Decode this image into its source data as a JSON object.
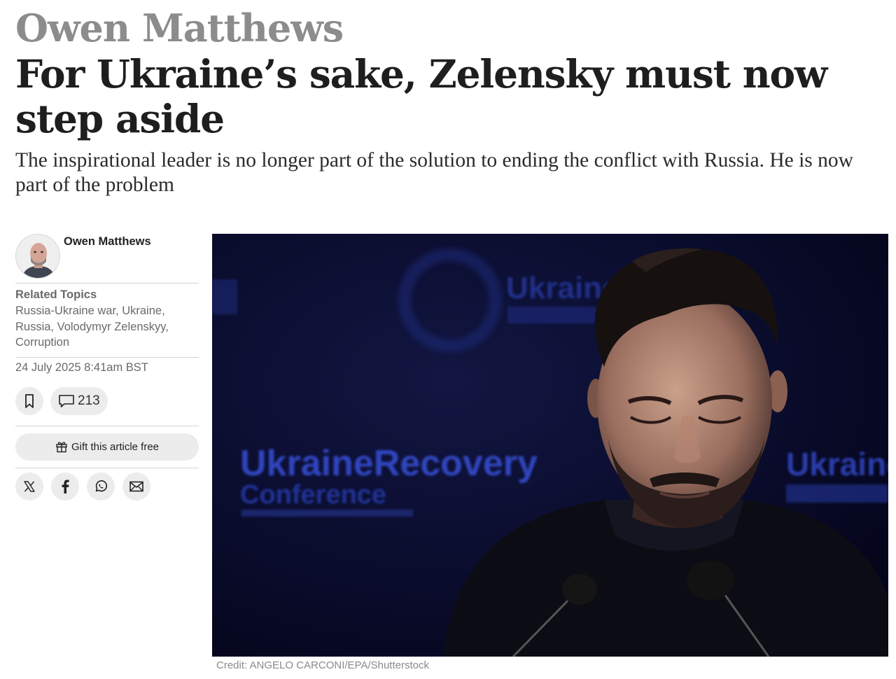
{
  "article": {
    "kicker": "Owen Matthews",
    "headline": "For Ukraine’s sake, Zelensky must now step aside",
    "standfirst": "The inspirational leader is no longer part of the solution to ending the conflict with Russia. He is now part of the problem"
  },
  "byline": {
    "author_name": "Owen Matthews",
    "related_label": "Related Topics",
    "related_topics": "Russia-Ukraine war, Ukraine, Russia, Volodymyr Zelenskyy, Corruption",
    "date": "24 July 2025 8:41am BST"
  },
  "actions": {
    "bookmark_icon": "bookmark-icon",
    "comments_icon": "comment-icon",
    "comment_count": "213",
    "gift_icon": "gift-icon",
    "gift_label": "Gift this article free"
  },
  "share": {
    "icons": [
      "x-icon",
      "facebook-icon",
      "whatsapp-icon",
      "email-icon"
    ]
  },
  "image": {
    "backdrop_text_main": "UkraineRecovery",
    "backdrop_text_sub": "Conference",
    "backdrop_text_small": "Ukraine",
    "credit": "Credit: ANGELO CARCONI/EPA/Shutterstock"
  }
}
